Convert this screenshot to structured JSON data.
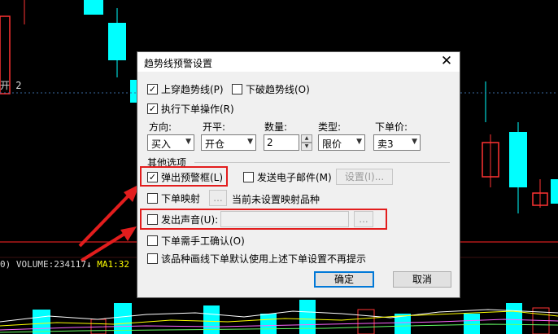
{
  "chart": {
    "kai_label": "开 2",
    "status_prefix": "0)",
    "volume_text": "VOLUME:234117",
    "arrow_glyph": "↓",
    "ma_text": "MA1:32",
    "colors": {
      "up": "#ff3333",
      "down": "#00ffff",
      "volume_text": "#d8d8d8",
      "ma": "#ffff00"
    }
  },
  "dialog": {
    "title": "趋势线预警设置",
    "close_glyph": "✕",
    "upcross": {
      "label": "上穿趋势线(P)",
      "checked": true
    },
    "downbreak": {
      "label": "下破趋势线(O)",
      "checked": false
    },
    "execute_order": {
      "label": "执行下单操作(R)",
      "checked": true
    },
    "fields": {
      "direction": {
        "label": "方向:",
        "value": "买入"
      },
      "open_close": {
        "label": "开平:",
        "value": "开仓"
      },
      "quantity": {
        "label": "数量:",
        "value": "2"
      },
      "type": {
        "label": "类型:",
        "value": "限价"
      },
      "price": {
        "label": "下单价:",
        "value": "卖3"
      }
    },
    "other_options_label": "其他选项",
    "popup_alert": {
      "label": "弹出预警框(L)",
      "checked": true
    },
    "send_email": {
      "label": "发送电子邮件(M)",
      "checked": false
    },
    "email_settings_button": "设置(I)...",
    "order_mapping": {
      "label": "下单映射",
      "checked": false
    },
    "order_mapping_button": "...",
    "mapping_note": "当前未设置映射品种",
    "play_sound": {
      "label": "发出声音(U):",
      "checked": false
    },
    "sound_browse_button": "...",
    "manual_confirm": {
      "label": "下单需手工确认(O)",
      "checked": false
    },
    "default_for_symbol": {
      "label": "该品种画线下单默认使用上述下单设置不再提示",
      "checked": false
    },
    "ok_button": "确定",
    "cancel_button": "取消"
  },
  "annotation_color": "#e21d1d"
}
